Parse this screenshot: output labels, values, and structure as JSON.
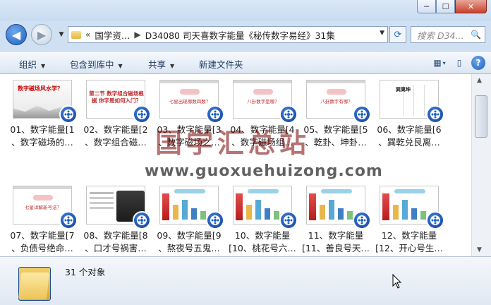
{
  "window": {
    "controls": {
      "minimize": "─",
      "maximize": "☐",
      "close": "✕"
    }
  },
  "nav": {
    "back_glyph": "◀",
    "forward_glyph": "▶",
    "history_dropdown": "▼",
    "address": {
      "overflow": "«",
      "segments": [
        "国学资…",
        "D34080 司天喜数字能量《秘传数字易经》31集"
      ],
      "separator": "▶",
      "dropdown": "▼"
    },
    "refresh_glyph": "⟳",
    "search": {
      "placeholder": "搜索 D34...",
      "icon": "search-icon"
    }
  },
  "toolbar": {
    "organize": "组织",
    "include_library": "包含到库中",
    "share": "共享",
    "new_folder": "新建文件夹",
    "caret": "▼",
    "view_glyph": "▦",
    "view_caret": "▾",
    "pane_glyph": "▯",
    "help_glyph": "?"
  },
  "files": [
    {
      "line1": "01、数字能量[1",
      "line2": "、数字磁场的…",
      "thumb": "ink",
      "thumb_text": "数字磁场风水学？"
    },
    {
      "line1": "02、数字能量[2",
      "line2": "、数字组合磁…",
      "thumb": "title",
      "thumb_text": "第二节 数字组合磁场根据 你字是如何入门？"
    },
    {
      "line1": "03、数字能量[3",
      "line2": "、数字磁场之…",
      "thumb": "step",
      "thumb_text": "七星出现哪数四数？"
    },
    {
      "line1": "04、数字能量[4",
      "line2": "、数字磁场组…",
      "thumb": "step",
      "thumb_text": "八卦数字是哪？"
    },
    {
      "line1": "05、数字能量[5",
      "line2": "、乾卦、坤卦…",
      "thumb": "step",
      "thumb_text": "八卦数字有哪？"
    },
    {
      "line1": "06、数字能量[6",
      "line2": "、巽乾兑艮离…",
      "thumb": "grid",
      "thumb_text": "巽离坤"
    },
    {
      "line1": "07、数字能量[7",
      "line2": "、负债号绝命…",
      "thumb": "step",
      "thumb_text": "七星详解新号法？"
    },
    {
      "line1": "08、数字能量[8",
      "line2": "、口才号祸害…",
      "thumb": "photo",
      "thumb_text": ""
    },
    {
      "line1": "09、数字能量[9",
      "line2": "、熬夜号五鬼…",
      "thumb": "chart",
      "thumb_text": ""
    },
    {
      "line1": "10、数字能量",
      "line2": "[10、桃花号六…",
      "thumb": "chart",
      "thumb_text": ""
    },
    {
      "line1": "11、数字能量",
      "line2": "[11、善良号天…",
      "thumb": "chart",
      "thumb_text": ""
    },
    {
      "line1": "12、数字能量",
      "line2": "[12、开心号生…",
      "thumb": "chart",
      "thumb_text": ""
    }
  ],
  "status": {
    "count": "31 个对象"
  },
  "watermark": {
    "cn": "国学汇总站",
    "url": "www.guoxuehuizong.com"
  }
}
